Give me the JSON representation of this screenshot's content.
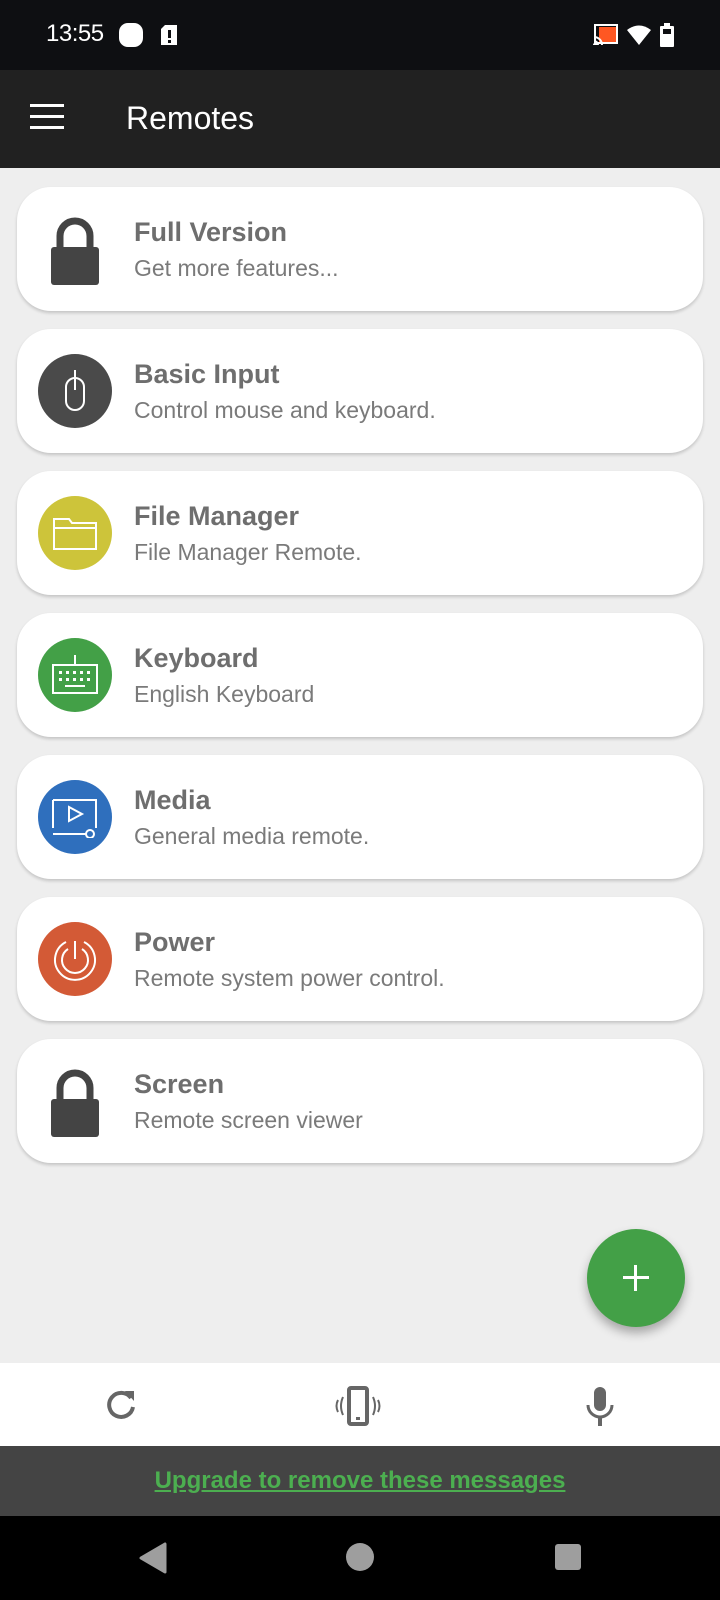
{
  "status_bar": {
    "time": "13:55",
    "left_icons": [
      "notification-blob-icon",
      "sim-alert-icon"
    ],
    "right_icons": [
      "cast-icon",
      "wifi-icon",
      "battery-icon"
    ],
    "cast_color": "#ff5722"
  },
  "app_bar": {
    "title": "Remotes",
    "menu_icon": "hamburger-menu-icon"
  },
  "remotes": [
    {
      "title": "Full Version",
      "subtitle": "Get more features...",
      "icon": "lock-icon",
      "color": "#444444"
    },
    {
      "title": "Basic Input",
      "subtitle": "Control mouse and keyboard.",
      "icon": "mouse-icon",
      "color": "#4a4a4a"
    },
    {
      "title": "File Manager",
      "subtitle": "File Manager Remote.",
      "icon": "folder-icon",
      "color": "#cdc43a"
    },
    {
      "title": "Keyboard",
      "subtitle": "English Keyboard",
      "icon": "keyboard-icon",
      "color": "#43a047"
    },
    {
      "title": "Media",
      "subtitle": "General media remote.",
      "icon": "media-play-icon",
      "color": "#2f6fbd"
    },
    {
      "title": "Power",
      "subtitle": "Remote system power control.",
      "icon": "power-icon",
      "color": "#d35a36"
    },
    {
      "title": "Screen",
      "subtitle": "Remote screen viewer",
      "icon": "lock-icon",
      "color": "#444444"
    }
  ],
  "fab": {
    "icon": "plus-icon",
    "color": "#43a047"
  },
  "toolbar": {
    "buttons": [
      {
        "icon": "refresh-icon"
      },
      {
        "icon": "phone-vibrate-icon"
      },
      {
        "icon": "microphone-icon"
      }
    ]
  },
  "ad_banner": {
    "link_text": "Upgrade to remove these messages",
    "link_color": "#4caf50"
  },
  "nav_bar": {
    "buttons": [
      "back-icon",
      "home-icon",
      "recents-icon"
    ]
  }
}
